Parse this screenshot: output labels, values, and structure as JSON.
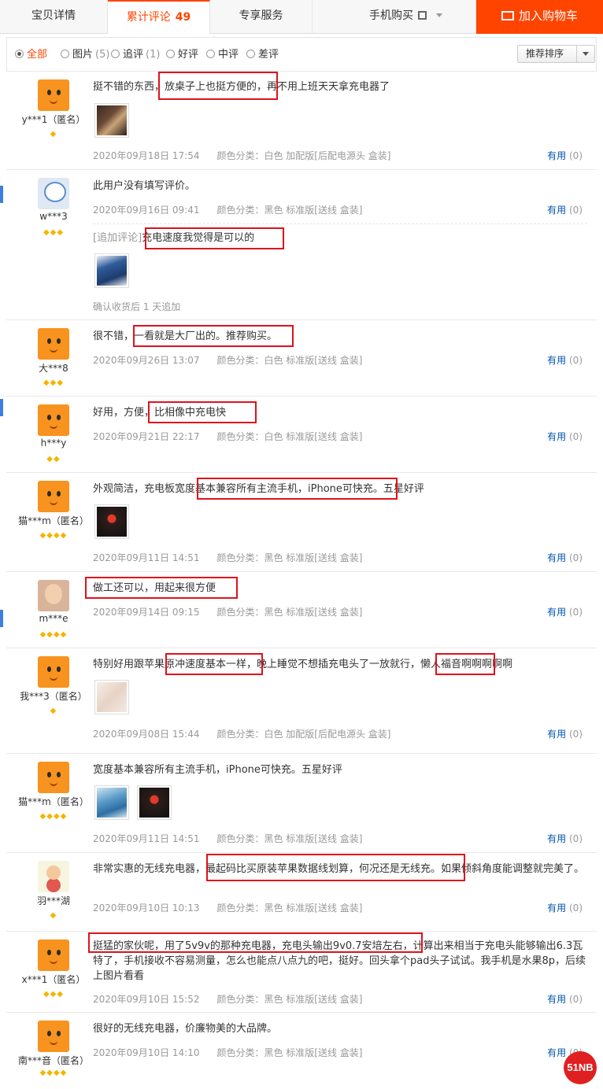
{
  "tabs": {
    "details": "宝贝详情",
    "reviews": "累计评论",
    "reviews_count": "49",
    "service": "专享服务",
    "mobile": "手机购买",
    "cart": "加入购物车"
  },
  "filter": {
    "all": "全部",
    "pictures": "图片",
    "pictures_count": "(5)",
    "followup": "追评",
    "followup_count": "(1)",
    "good": "好评",
    "neutral": "中评",
    "bad": "差评",
    "sort": "推荐排序"
  },
  "useful_label": "有用",
  "useful_count": "(0)",
  "reviews": [
    {
      "user": "y***1（匿名）",
      "gems": "◆",
      "text": "挺不错的东西，放桌子上也挺方便的，再不用上班天天拿充电器了",
      "date": "2020年09月18日 17:54",
      "sku": "颜色分类：白色 加配版[后配电源头 盒装]"
    },
    {
      "user": "w***3",
      "gems": "◆◆◆",
      "text": "此用户没有填写评价。",
      "date": "2020年09月16日 09:41",
      "sku": "颜色分类：黑色 标准版[送线 盒装]",
      "addition_label": "[追加评论]",
      "addition_text": "充电速度我觉得是可以的",
      "addition_note": "确认收货后 1 天追加"
    },
    {
      "user": "大***8",
      "gems": "◆◆◆",
      "text": "很不错，一看就是大厂出的。推荐购买。",
      "date": "2020年09月26日 13:07",
      "sku": "颜色分类：白色 标准版[送线 盒装]"
    },
    {
      "user": "h***y",
      "gems": "◆◆",
      "text": "好用，方便，比相像中充电快",
      "date": "2020年09月21日 22:17",
      "sku": "颜色分类：白色 标准版[送线 盒装]"
    },
    {
      "user": "猫***m（匿名）",
      "gems": "◆◆◆◆",
      "text": "外观简洁，充电板宽度基本兼容所有主流手机，iPhone可快充。五星好评",
      "date": "2020年09月11日 14:51",
      "sku": "颜色分类：黑色 标准版[送线 盒装]"
    },
    {
      "user": "m***e",
      "gems": "◆◆◆◆",
      "text": "做工还可以，用起来很方便",
      "date": "2020年09月14日 09:15",
      "sku": "颜色分类：黑色 标准版[送线 盒装]"
    },
    {
      "user": "我***3（匿名）",
      "gems": "◆",
      "text": "特别好用跟苹果原冲速度基本一样，晚上睡觉不想插充电头了一放就行，懒人福音啊啊啊啊啊",
      "date": "2020年09月08日 15:44",
      "sku": "颜色分类：白色 加配版[后配电源头 盒装]"
    },
    {
      "user": "猫***m（匿名）",
      "gems": "◆◆◆◆",
      "text": "宽度基本兼容所有主流手机，iPhone可快充。五星好评",
      "date": "2020年09月11日 14:51",
      "sku": "颜色分类：黑色 标准版[送线 盒装]"
    },
    {
      "user": "羽***湖",
      "gems": "◆",
      "text": "非常实惠的无线充电器，最起码比买原装苹果数据线划算，何况还是无线充。如果倾斜角度能调整就完美了。",
      "date": "2020年09月10日 10:13",
      "sku": "颜色分类：黑色 标准版[送线 盒装]"
    },
    {
      "user": "x***1（匿名）",
      "gems": "◆◆◆",
      "text": "挺猛的家伙呢，用了5v9v的那种充电器，充电头输出9v0.7安培左右，计算出来相当于充电头能够输出6.3瓦特了，手机接收不容易测量，怎么也能点八点九的吧，挺好。回头拿个pad头子试试。我手机是水果8p，后续上图片看看",
      "date": "2020年09月10日 15:52",
      "sku": "颜色分类：黑色 标准版[送线 盒装]"
    },
    {
      "user": "南***音（匿名）",
      "gems": "◆◆◆◆",
      "text": "很好的无线充电器，价廉物美的大品牌。",
      "date": "2020年09月10日 14:10",
      "sku": "颜色分类：黑色 标准版[送线 盒装]"
    }
  ],
  "watermark": "51NB",
  "colors": {
    "accent": "#ff4400",
    "highlight_box": "#e0111b",
    "link": "#0056b3",
    "gem": "#f5b400"
  }
}
